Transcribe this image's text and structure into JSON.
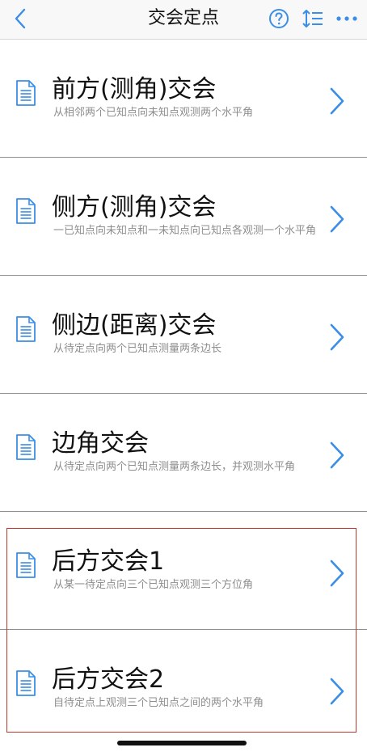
{
  "header": {
    "title": "交会定点",
    "back_icon": "chevron-left-icon",
    "help_icon": "question-circle-icon",
    "sort_icon": "sort-list-icon",
    "more_icon": "more-horizontal-icon"
  },
  "colors": {
    "accent": "#3a8ee6",
    "text_primary": "#111111",
    "text_secondary": "#8e8e8e",
    "divider": "#8e8e8e",
    "highlight": "#c0392b"
  },
  "items": [
    {
      "title": "前方(测角)交会",
      "subtitle": "从相邻两个已知点向未知点观测两个水平角"
    },
    {
      "title": "侧方(测角)交会",
      "subtitle": "一已知点向未知点和一未知点向已知点各观测一个水平角"
    },
    {
      "title": "侧边(距离)交会",
      "subtitle": "从待定点向两个已知点测量两条边长"
    },
    {
      "title": "边角交会",
      "subtitle": "从待定点向两个已知点测量两条边长，并观测水平角"
    },
    {
      "title": "后方交会1",
      "subtitle": "从某一待定点向三个已知点观测三个方位角"
    },
    {
      "title": "后方交会2",
      "subtitle": "自待定点上观测三个已知点之间的两个水平角"
    }
  ]
}
